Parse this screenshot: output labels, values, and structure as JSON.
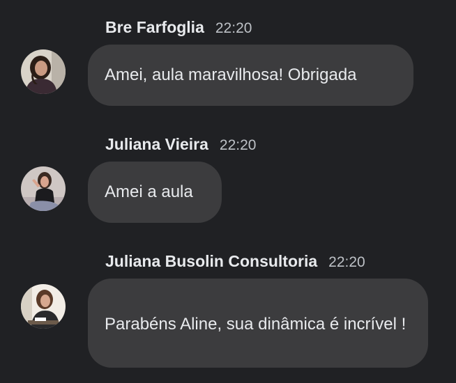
{
  "messages": [
    {
      "sender": "Bre Farfoglia",
      "time": "22:20",
      "text": "Amei, aula maravilhosa! Obrigada",
      "avatar_icon": "profile-photo-woman-dark-hair",
      "avatar_colors": {
        "bg": "#d9d3c9",
        "hair": "#2a1d16",
        "skin": "#c99a82",
        "shirt": "#3a2a33"
      }
    },
    {
      "sender": "Juliana Vieira",
      "time": "22:20",
      "text": "Amei a aula",
      "avatar_icon": "profile-photo-woman-posing",
      "avatar_colors": {
        "bg": "#cfc7c4",
        "hair": "#3b2a22",
        "skin": "#d9a48e",
        "shirt": "#1b1b1e"
      }
    },
    {
      "sender": "Juliana Busolin Consultoria",
      "time": "22:20",
      "text": "Parabéns Aline, sua dinâmica é incrível !",
      "avatar_icon": "profile-photo-woman-at-desk",
      "avatar_colors": {
        "bg": "#f2ede6",
        "hair": "#5a3a28",
        "skin": "#d7a88f",
        "shirt": "#2a2a2c"
      }
    }
  ],
  "theme": {
    "background": "#202124",
    "bubble": "#3c3c3e",
    "text": "#e8eaed",
    "time": "#bdc1c6"
  }
}
